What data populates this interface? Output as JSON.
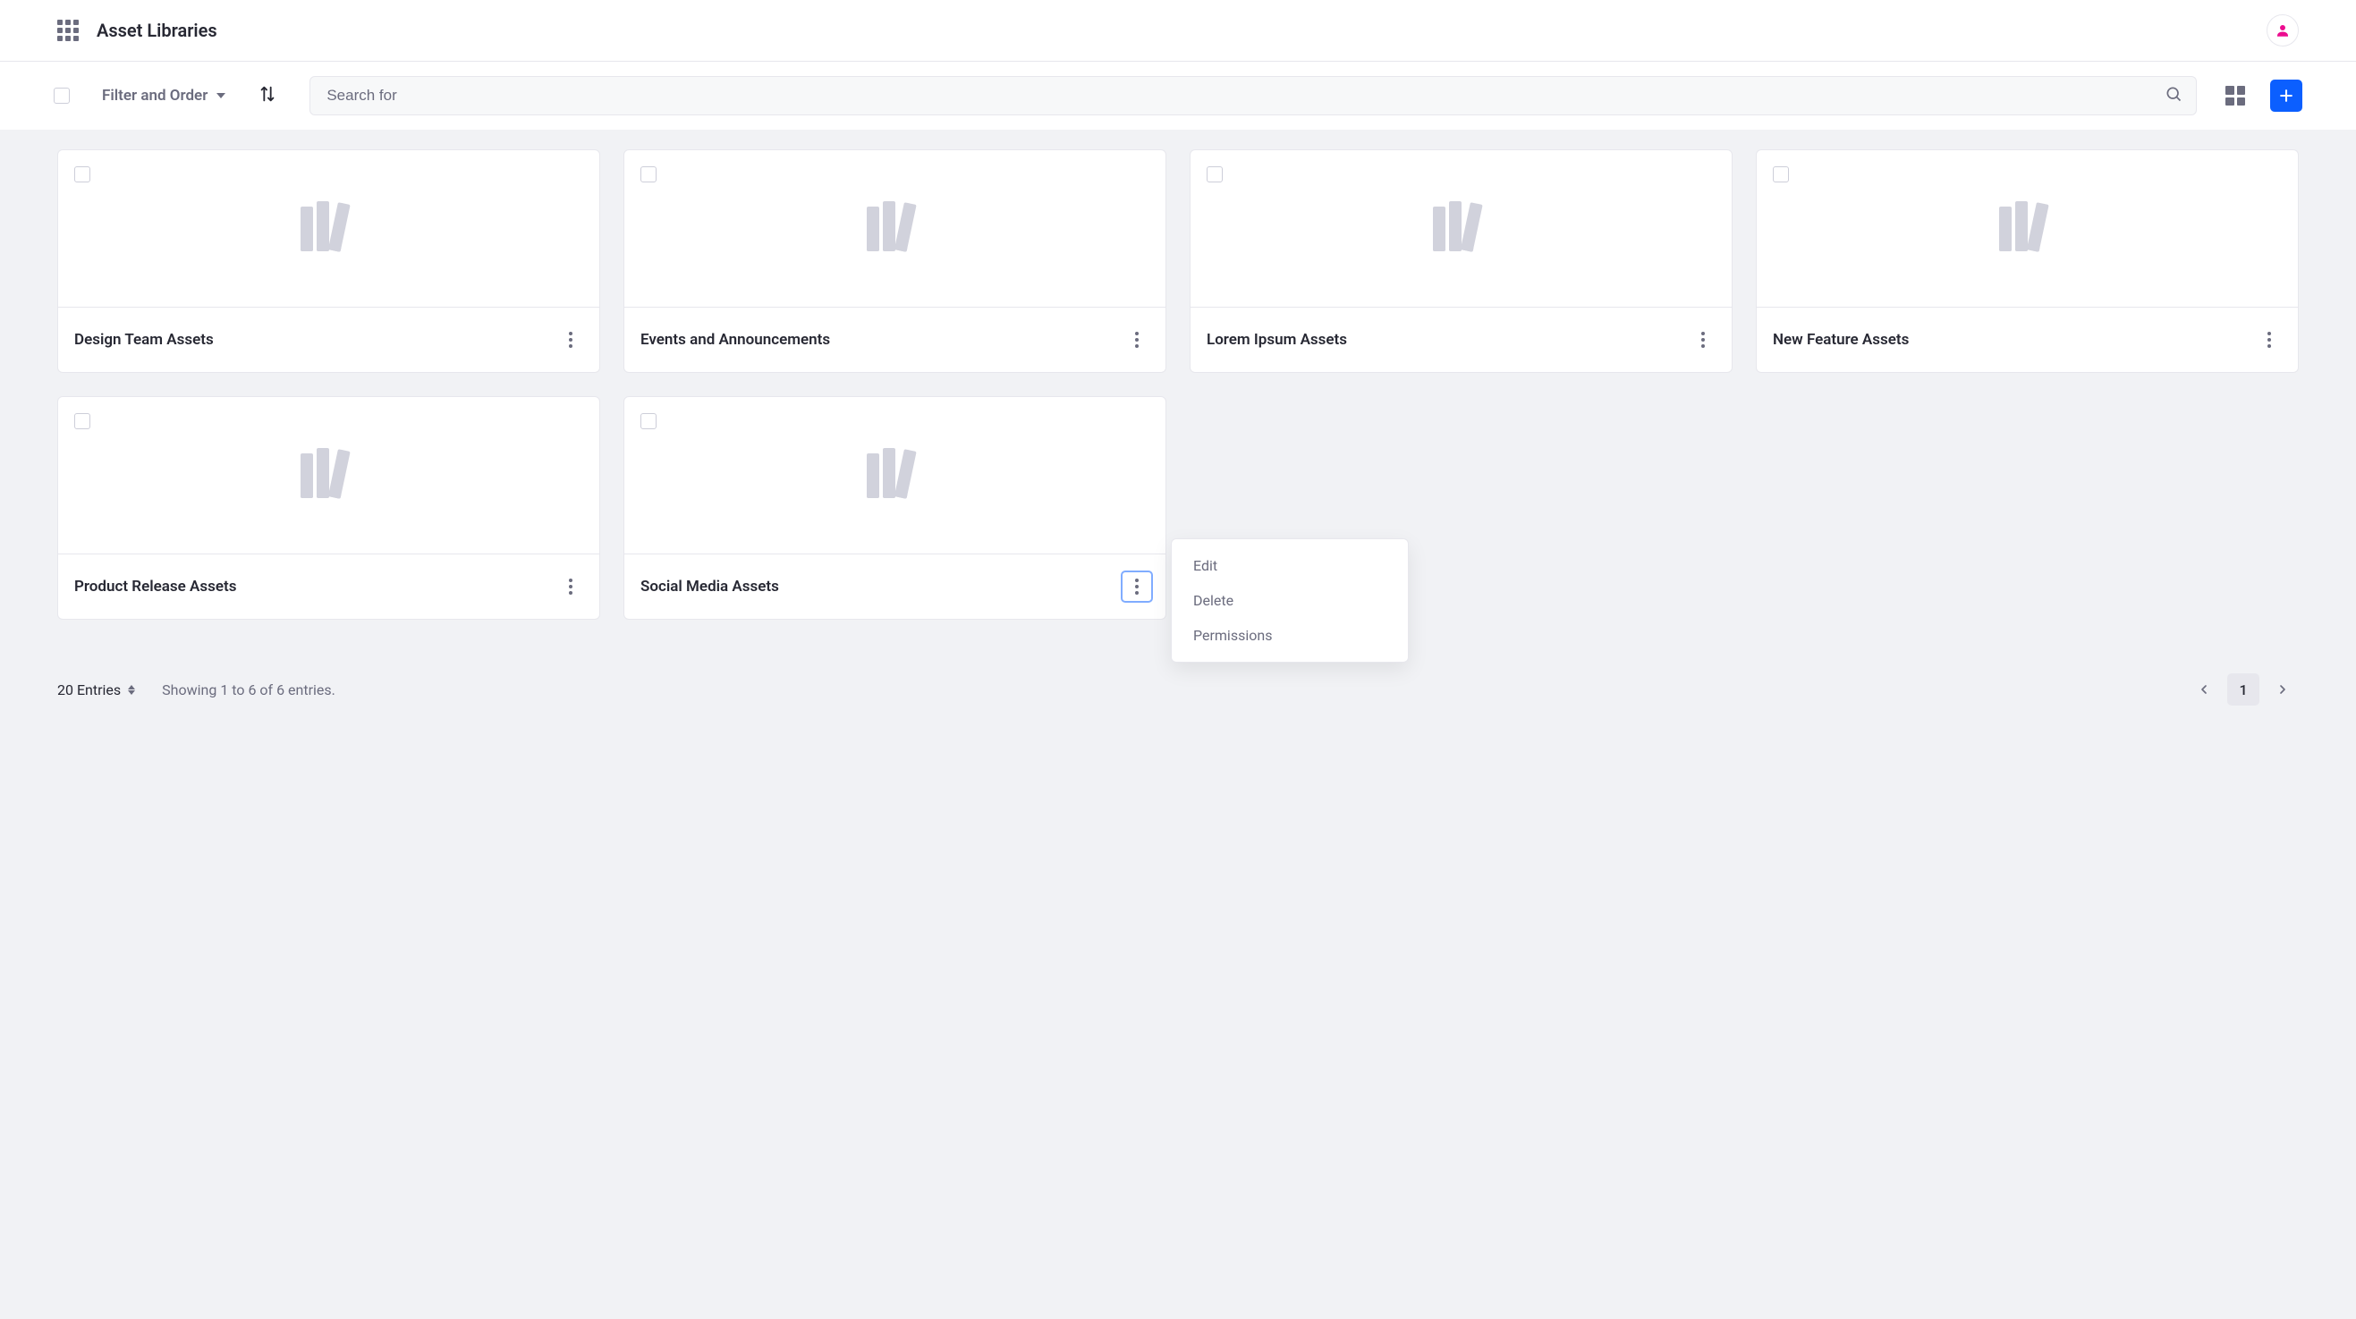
{
  "header": {
    "title": "Asset Libraries"
  },
  "toolbar": {
    "filter_label": "Filter and Order",
    "search_placeholder": "Search for"
  },
  "cards": [
    {
      "title": "Design Team Assets",
      "menu_open": false
    },
    {
      "title": "Events and Announcements",
      "menu_open": false
    },
    {
      "title": "Lorem Ipsum Assets",
      "menu_open": false
    },
    {
      "title": "New Feature Assets",
      "menu_open": false
    },
    {
      "title": "Product Release Assets",
      "menu_open": false
    },
    {
      "title": "Social Media Assets",
      "menu_open": true
    }
  ],
  "context_menu": {
    "items": [
      "Edit",
      "Delete",
      "Permissions"
    ]
  },
  "pagination": {
    "entries_label": "20 Entries",
    "showing_text": "Showing 1 to 6 of 6 entries.",
    "current_page": "1"
  }
}
